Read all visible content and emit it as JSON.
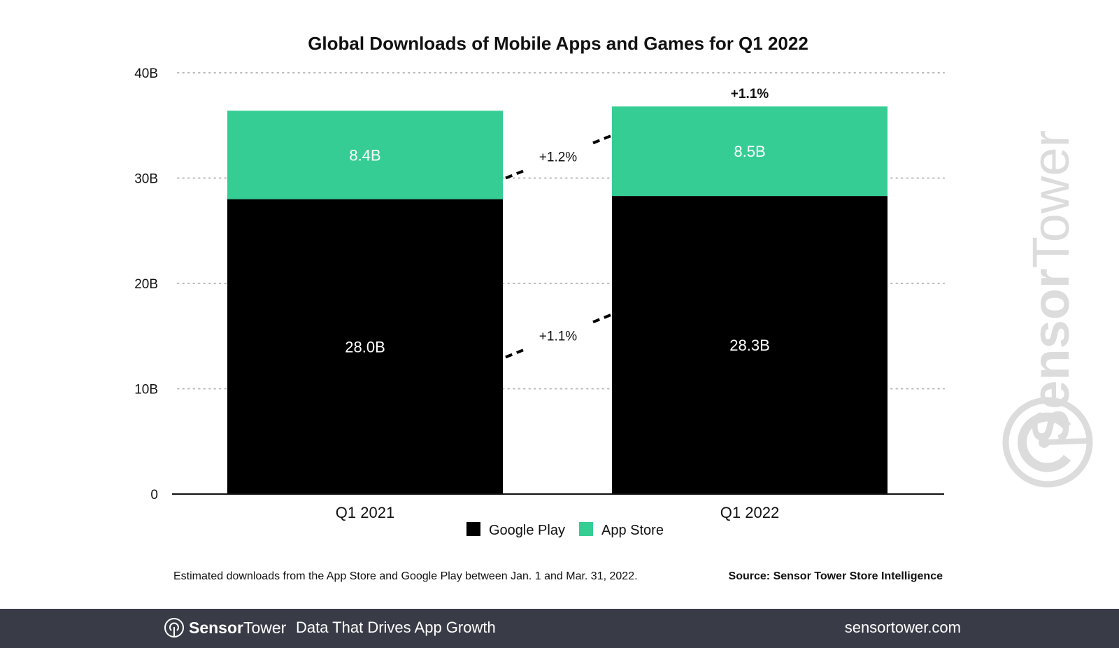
{
  "chart_data": {
    "type": "bar",
    "stacked": true,
    "title": "Global Downloads of Mobile Apps and Games for Q1 2022",
    "xlabel": "",
    "ylabel": "",
    "categories": [
      "Q1 2021",
      "Q1 2022"
    ],
    "series": [
      {
        "name": "Google Play",
        "color": "#000000",
        "values": [
          28.0,
          28.3
        ],
        "labels": [
          "28.0B",
          "28.3B"
        ]
      },
      {
        "name": "App Store",
        "color": "#36cd94",
        "values": [
          8.4,
          8.5
        ],
        "labels": [
          "8.4B",
          "8.5B"
        ]
      }
    ],
    "ylim": [
      0,
      40
    ],
    "yticks": [
      0,
      10,
      20,
      30,
      40
    ],
    "ytick_labels": [
      "0",
      "10B",
      "20B",
      "30B",
      "40B"
    ],
    "grid": "dotted horizontal",
    "legend": {
      "placement": "bottom-center",
      "entries": [
        "Google Play",
        "App Store"
      ]
    },
    "annotations": {
      "total_growth": "+1.1%",
      "app_store_growth": "+1.2%",
      "google_play_growth": "+1.1%"
    },
    "note": "Estimated downloads from the App Store and Google Play between Jan. 1 and Mar. 31, 2022.",
    "source": "Source: Sensor Tower Store Intelligence"
  },
  "watermark": {
    "bold": "Sensor",
    "light": "Tower"
  },
  "footer": {
    "brand_bold": "Sensor",
    "brand_light": "Tower",
    "tagline": "Data That Drives App Growth",
    "url": "sensortower.com"
  }
}
